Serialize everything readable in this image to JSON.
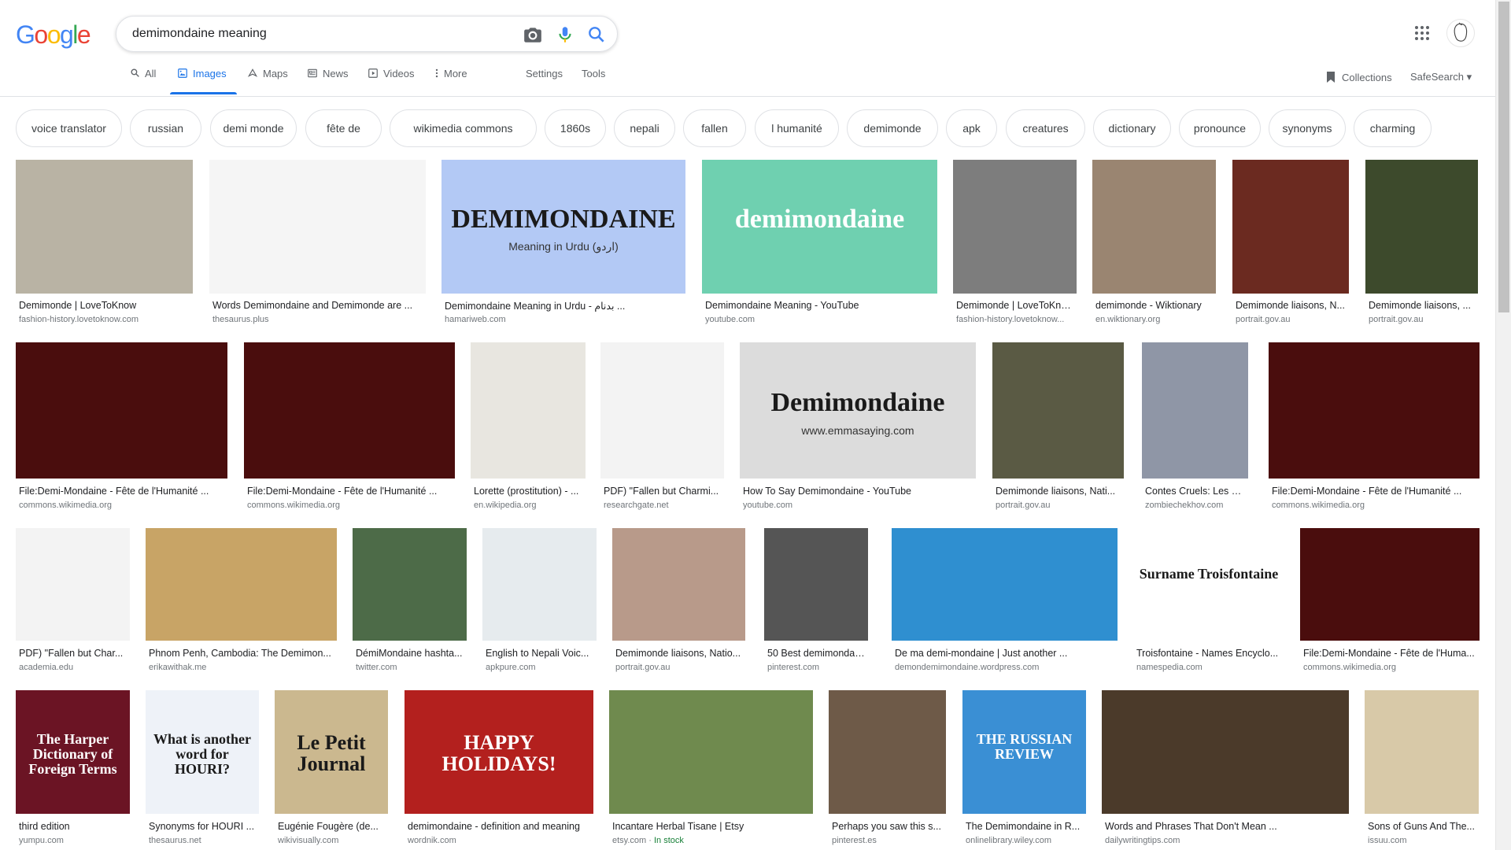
{
  "search": {
    "query": "demimondaine meaning"
  },
  "logo": {
    "letters": [
      "G",
      "o",
      "o",
      "g",
      "l",
      "e"
    ],
    "colors": [
      "#4285f4",
      "#ea4335",
      "#fbbc05",
      "#4285f4",
      "#34a853",
      "#ea4335"
    ]
  },
  "tabs": [
    {
      "label": "All",
      "icon": "search-icon"
    },
    {
      "label": "Images",
      "icon": "image-icon"
    },
    {
      "label": "Maps",
      "icon": "map-icon"
    },
    {
      "label": "News",
      "icon": "news-icon"
    },
    {
      "label": "Videos",
      "icon": "video-icon"
    },
    {
      "label": "More",
      "icon": "more-vert-icon"
    },
    {
      "label": "Settings"
    },
    {
      "label": "Tools"
    }
  ],
  "collections_label": "Collections",
  "safesearch_label": "SafeSearch",
  "accent_color": "#1a73e8",
  "chips": [
    "voice translator",
    "russian",
    "demi monde",
    "fête de",
    "wikimedia commons",
    "1860s",
    "nepali",
    "fallen",
    "l humanité",
    "demimonde",
    "apk",
    "creatures",
    "dictionary",
    "pronounce",
    "synonyms",
    "charming"
  ],
  "results": [
    [
      {
        "title": "Demimonde | LoveToKnow",
        "domain": "fashion-history.lovetoknow.com",
        "color": "#b9b3a4"
      },
      {
        "title": "Words Demimondaine and Demimonde are ...",
        "domain": "thesaurus.plus",
        "color": "#f5f5f5"
      },
      {
        "title": "Demimondaine Meaning in Urdu - بدنام ...",
        "domain": "hamariweb.com",
        "color": "#b3c9f5",
        "overlay": [
          "DEMIMONDAINE",
          "Meaning in Urdu (اردو)"
        ]
      },
      {
        "title": "Demimondaine Meaning - YouTube",
        "domain": "youtube.com",
        "color": "#6fd0b0",
        "overlay": [
          "demimondaine"
        ]
      },
      {
        "title": "Demimonde | LoveToKnow",
        "domain": "fashion-history.lovetoknow...",
        "color": "#7d7d7d"
      },
      {
        "title": "demimonde - Wiktionary",
        "domain": "en.wiktionary.org",
        "color": "#9a8571"
      },
      {
        "title": "Demimonde liaisons, N...",
        "domain": "portrait.gov.au",
        "color": "#6b2a20"
      },
      {
        "title": "Demimonde liaisons, ...",
        "domain": "portrait.gov.au",
        "color": "#3d4a2c"
      }
    ],
    [
      {
        "title": "File:Demi-Mondaine - Fête de l'Humanité ...",
        "domain": "commons.wikimedia.org",
        "color": "#4a0d0d"
      },
      {
        "title": "File:Demi-Mondaine - Fête de l'Humanité ...",
        "domain": "commons.wikimedia.org",
        "color": "#4a0d0d"
      },
      {
        "title": "Lorette (prostitution) - ...",
        "domain": "en.wikipedia.org",
        "color": "#e8e6e0"
      },
      {
        "title": "PDF) \"Fallen but Charmi...",
        "domain": "researchgate.net",
        "color": "#f3f3f3"
      },
      {
        "title": "How To Say Demimondaine - YouTube",
        "domain": "youtube.com",
        "color": "#dcdcdc",
        "overlay": [
          "Demimondaine",
          "www.emmasaying.com"
        ]
      },
      {
        "title": "Demimonde liaisons, Nati...",
        "domain": "portrait.gov.au",
        "color": "#5a5a44"
      },
      {
        "title": "Contes Cruels: Les De...",
        "domain": "zombiechekhov.com",
        "color": "#8f96a6"
      },
      {
        "title": "File:Demi-Mondaine - Fête de l'Humanité ...",
        "domain": "commons.wikimedia.org",
        "color": "#4a0d0d"
      }
    ],
    [
      {
        "title": "PDF) \"Fallen but Char...",
        "domain": "academia.edu",
        "color": "#f3f3f3"
      },
      {
        "title": "Phnom Penh, Cambodia: The Demimon...",
        "domain": "erikawithak.me",
        "color": "#c8a466"
      },
      {
        "title": "DémiMondaine hashta...",
        "domain": "twitter.com",
        "color": "#4d6b48"
      },
      {
        "title": "English to Nepali Voic...",
        "domain": "apkpure.com",
        "color": "#e6ebee"
      },
      {
        "title": "Demimonde liaisons, Natio...",
        "domain": "portrait.gov.au",
        "color": "#b89a8a"
      },
      {
        "title": "50 Best demimondain...",
        "domain": "pinterest.com",
        "color": "#555555"
      },
      {
        "title": "De ma demi-mondaine | Just another ...",
        "domain": "demondemimondaine.wordpress.com",
        "color": "#2f8fd0"
      },
      {
        "title": "Troisfontaine - Names Encyclo...",
        "domain": "namespedia.com",
        "color": "#ffffff",
        "overlay": [
          "Surname Troisfontaine"
        ]
      },
      {
        "title": "File:Demi-Mondaine - Fête de l'Huma...",
        "domain": "commons.wikimedia.org",
        "color": "#4a0d0d"
      }
    ],
    [
      {
        "title": "third edition",
        "domain": "yumpu.com",
        "color": "#6b1424",
        "overlay": [
          "The Harper Dictionary of Foreign Terms"
        ]
      },
      {
        "title": "Synonyms for HOURI ...",
        "domain": "thesaurus.net",
        "color": "#eef2f8",
        "overlay": [
          "What is another word for HOURI?"
        ]
      },
      {
        "title": "Eugénie Fougère (de...",
        "domain": "wikivisually.com",
        "color": "#cbb88f",
        "overlay": [
          "Le Petit Journal"
        ]
      },
      {
        "title": "demimondaine - definition and meaning",
        "domain": "wordnik.com",
        "color": "#b3201e",
        "overlay": [
          "HAPPY HOLIDAYS!"
        ]
      },
      {
        "title": "Incantare Herbal Tisane | Etsy",
        "domain": "etsy.com",
        "stock": "In stock",
        "color": "#6f8a4e"
      },
      {
        "title": "Perhaps you saw this s...",
        "domain": "pinterest.es",
        "color": "#6e5a48"
      },
      {
        "title": "The Demimondaine in R...",
        "domain": "onlinelibrary.wiley.com",
        "color": "#3a8fd4",
        "overlay": [
          "THE RUSSIAN REVIEW"
        ]
      },
      {
        "title": "Words and Phrases That Don't Mean ...",
        "domain": "dailywritingtips.com",
        "color": "#4b3a2a"
      },
      {
        "title": "Sons of Guns And The...",
        "domain": "issuu.com",
        "color": "#d8c9a8"
      }
    ]
  ]
}
